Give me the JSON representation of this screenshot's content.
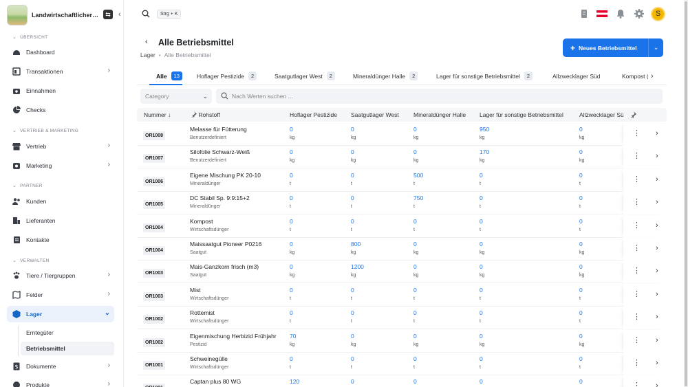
{
  "org": {
    "name": "Landwirtschaftlicher B..."
  },
  "sidebar": {
    "sections": {
      "overview": "ÜBERSICHT",
      "sales": "VERTRIEB & MARKETING",
      "partner": "PARTNER",
      "manage": "VERWALTEN"
    },
    "items": {
      "dashboard": "Dashboard",
      "transaktionen": "Transaktionen",
      "einnahmen": "Einnahmen",
      "checks": "Checks",
      "vertrieb": "Vertrieb",
      "marketing": "Marketing",
      "kunden": "Kunden",
      "lieferanten": "Lieferanten",
      "kontakte": "Kontakte",
      "tiere": "Tiere / Tiergruppen",
      "felder": "Felder",
      "lager": "Lager",
      "dokumente": "Dokumente",
      "produkte": "Produkte"
    },
    "lager_sub": {
      "ernteguter": "Erntegüter",
      "betriebsmittel": "Betriebsmittel"
    }
  },
  "topbar": {
    "shortcut": "Strg + K",
    "avatar_initial": "S"
  },
  "page": {
    "title": "Alle Betriebsmittel",
    "breadcrumb": {
      "parent": "Lager",
      "sep": "•",
      "current": "Alle Betriebsmittel"
    },
    "new_button": "Neues Betriebsmittel",
    "plus": "+"
  },
  "tabs": [
    {
      "label": "Alle",
      "count": "13"
    },
    {
      "label": "Hoflager Pestizide",
      "count": "2"
    },
    {
      "label": "Saatgutlager West",
      "count": "2"
    },
    {
      "label": "Mineraldünger Halle",
      "count": "2"
    },
    {
      "label": "Lager für sonstige Betriebsmittel",
      "count": "2"
    },
    {
      "label": "Allzwecklager Süd",
      "count": ""
    },
    {
      "label": "Kompost (",
      "count": ""
    }
  ],
  "filters": {
    "category_placeholder": "Category",
    "search_placeholder": "Nach Werten suchen ..."
  },
  "table": {
    "headers": {
      "nummer": "Nummer",
      "rohstoff": "Rohstoff",
      "c1": "Hoflager Pestizide",
      "c2": "Saatgutlager West",
      "c3": "Mineraldünger Halle",
      "c4": "Lager für sonstige Betriebsmittel",
      "c5": "Allzwecklager Sü"
    },
    "rows": [
      {
        "code": "OR1008",
        "name": "Melasse für Fütterung",
        "cat": "Benutzerdefiniert",
        "v": [
          "0",
          "0",
          "0",
          "950",
          "0"
        ],
        "u": [
          "kg",
          "kg",
          "kg",
          "kg",
          "kg"
        ]
      },
      {
        "code": "OR1007",
        "name": "Silofolie Schwarz-Weiß",
        "cat": "Benutzerdefiniert",
        "v": [
          "0",
          "0",
          "0",
          "170",
          "0"
        ],
        "u": [
          "kg",
          "kg",
          "kg",
          "kg",
          "kg"
        ]
      },
      {
        "code": "OR1006",
        "name": "Eigene Mischung PK 20-10",
        "cat": "Mineraldünger",
        "v": [
          "0",
          "0",
          "500",
          "0",
          "0"
        ],
        "u": [
          "t",
          "t",
          "t",
          "t",
          "t"
        ]
      },
      {
        "code": "OR1005",
        "name": "DC Stabil Sp. 9:9:15+2",
        "cat": "Mineraldünger",
        "v": [
          "0",
          "0",
          "750",
          "0",
          "0"
        ],
        "u": [
          "t",
          "t",
          "t",
          "t",
          "t"
        ]
      },
      {
        "code": "OR1004",
        "name": "Kompost",
        "cat": "Wirtschaftsdünger",
        "v": [
          "0",
          "0",
          "0",
          "0",
          "0"
        ],
        "u": [
          "t",
          "t",
          "t",
          "t",
          "t"
        ]
      },
      {
        "code": "OR1004",
        "name": "Maissaatgut Pioneer P0216",
        "cat": "Saatgut",
        "v": [
          "0",
          "800",
          "0",
          "0",
          "0"
        ],
        "u": [
          "kg",
          "kg",
          "kg",
          "kg",
          "kg"
        ]
      },
      {
        "code": "OR1003",
        "name": "Mais-Ganzkorn frisch (m3)",
        "cat": "Saatgut",
        "v": [
          "0",
          "1200",
          "0",
          "0",
          "0"
        ],
        "u": [
          "kg",
          "kg",
          "kg",
          "kg",
          "kg"
        ]
      },
      {
        "code": "OR1003",
        "name": "Mist",
        "cat": "Wirtschaftsdünger",
        "v": [
          "0",
          "0",
          "0",
          "0",
          "0"
        ],
        "u": [
          "t",
          "t",
          "t",
          "t",
          "t"
        ]
      },
      {
        "code": "OR1002",
        "name": "Rottemist",
        "cat": "Wirtschaftsdünger",
        "v": [
          "0",
          "0",
          "0",
          "0",
          "0"
        ],
        "u": [
          "t",
          "t",
          "t",
          "t",
          "t"
        ]
      },
      {
        "code": "OR1002",
        "name": "Eigenmischung Herbizid Frühjahr",
        "cat": "Pestizid",
        "v": [
          "70",
          "0",
          "0",
          "0",
          "0"
        ],
        "u": [
          "kg",
          "kg",
          "kg",
          "kg",
          "kg"
        ]
      },
      {
        "code": "OR1001",
        "name": "Schweinegülle",
        "cat": "Wirtschaftsdünger",
        "v": [
          "0",
          "0",
          "0",
          "0",
          "0"
        ],
        "u": [
          "t",
          "t",
          "t",
          "t",
          "t"
        ]
      },
      {
        "code": "OR1001",
        "name": "Captan plus 80 WG",
        "cat": "",
        "v": [
          "120",
          "0",
          "0",
          "0",
          "0"
        ],
        "u": [
          "",
          "",
          "",
          "",
          ""
        ]
      }
    ]
  },
  "colors": {
    "accent": "#1a73e8",
    "active_bg": "#eaf1fb",
    "avatar": "#f5b800"
  }
}
